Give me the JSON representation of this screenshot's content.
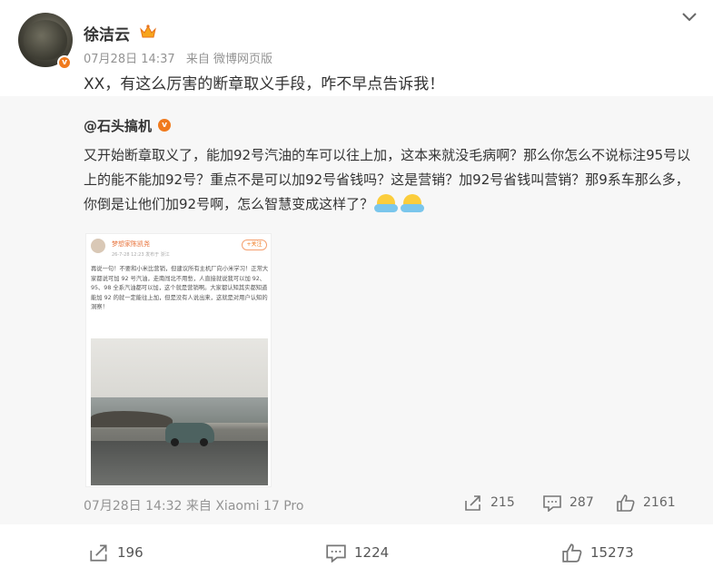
{
  "post": {
    "author": "徐洁云",
    "date": "07月28日 14:37",
    "source": "来自 微博网页版",
    "text": "XX，有这么厉害的断章取义手段，咋不早点告诉我！"
  },
  "repost": {
    "author": "@石头搞机",
    "text": "又开始断章取义了，能加92号汽油的车可以往上加，这本来就没毛病啊？那么你怎么不说标注95号以上的能不能加92号？重点不是可以加92号省钱吗？这是营销？加92号省钱叫营销？那9系车那么多，你倒是让他们加92号啊，怎么智慧变成这样了？",
    "date": "07月28日 14:32",
    "source": "来自 Xiaomi 17 Pro",
    "reposts": "215",
    "comments": "287",
    "likes": "2161",
    "screenshot": {
      "name": "梦想家陈凯尧",
      "meta": "26-7-28 12:23  发布于 浙江",
      "follow": "+关注",
      "text": "再说一句！不要和小米比营销，但建议所有主机厂向小米学习！正常大家都说可加 92 号汽油，走南闯北不用愁，人直接就说我可以加 92、95、98 全系汽油都可以加，这个就是营销啊。大家都认知其实都知道能加 92 的就一定能往上加，但是没有人说出来，这就是对用户认知的洞察！"
    }
  },
  "actions": {
    "reposts": "196",
    "comments": "1224",
    "likes": "15273"
  },
  "colors": {
    "accent": "#f07a1d",
    "meta": "#939393",
    "repost_bg": "#f7f7f7"
  }
}
